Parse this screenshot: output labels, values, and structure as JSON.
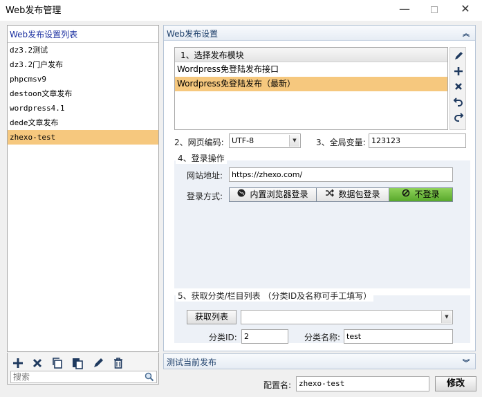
{
  "window": {
    "title": "Web发布管理",
    "minimize": "—",
    "close": "✕"
  },
  "left": {
    "header": "Web发布设置列表",
    "items": [
      {
        "label": "dz3.2测试"
      },
      {
        "label": "dz3.2门户发布"
      },
      {
        "label": "phpcmsv9"
      },
      {
        "label": "destoon文章发布"
      },
      {
        "label": "wordpress4.1"
      },
      {
        "label": "dede文章发布"
      },
      {
        "label": "zhexo-test",
        "selected": true
      }
    ],
    "search_placeholder": "搜索",
    "toolbar_icons": [
      "add-icon",
      "delete-icon",
      "copy-icon",
      "paste-icon",
      "edit-icon",
      "trash-icon"
    ]
  },
  "right": {
    "header": "Web发布设置",
    "module_box": {
      "title": "1、选择发布模块",
      "items": [
        {
          "label": "Wordpress免登陆发布接口"
        },
        {
          "label": "Wordpress免登陆发布（最新）",
          "selected": true
        }
      ],
      "tool_icons": [
        "pencil-icon",
        "plus-icon",
        "close-icon",
        "undo-icon",
        "redo-icon"
      ]
    },
    "encoding": {
      "label": "2、网页编码:",
      "value": "UTF-8"
    },
    "global_var": {
      "label": "3、全局变量:",
      "value": "123123"
    },
    "login": {
      "section_label": "4、登录操作",
      "site_label": "网站地址:",
      "site_value": "https://zhexo.com/",
      "method_label": "登录方式:",
      "methods": [
        {
          "label": "内置浏览器登录",
          "icon": "globe-icon"
        },
        {
          "label": "数据包登录",
          "icon": "shuffle-icon"
        },
        {
          "label": "不登录",
          "icon": "ban-icon",
          "active": true
        }
      ]
    },
    "category": {
      "section_label": "5、获取分类/栏目列表 （分类ID及名称可手工填写）",
      "fetch_button": "获取列表",
      "dropdown_value": "",
      "id_label": "分类ID:",
      "id_value": "2",
      "name_label": "分类名称:",
      "name_value": "test"
    },
    "test_header": "测试当前发布"
  },
  "footer": {
    "config_name_label": "配置名:",
    "config_name_value": "zhexo-test",
    "modify_button": "修改"
  },
  "colors": {
    "selected_row": "#f6c87e",
    "active_green": "#6cbf3a",
    "header_text": "#1d3f6a",
    "list_header_text": "#1a2fa0"
  }
}
